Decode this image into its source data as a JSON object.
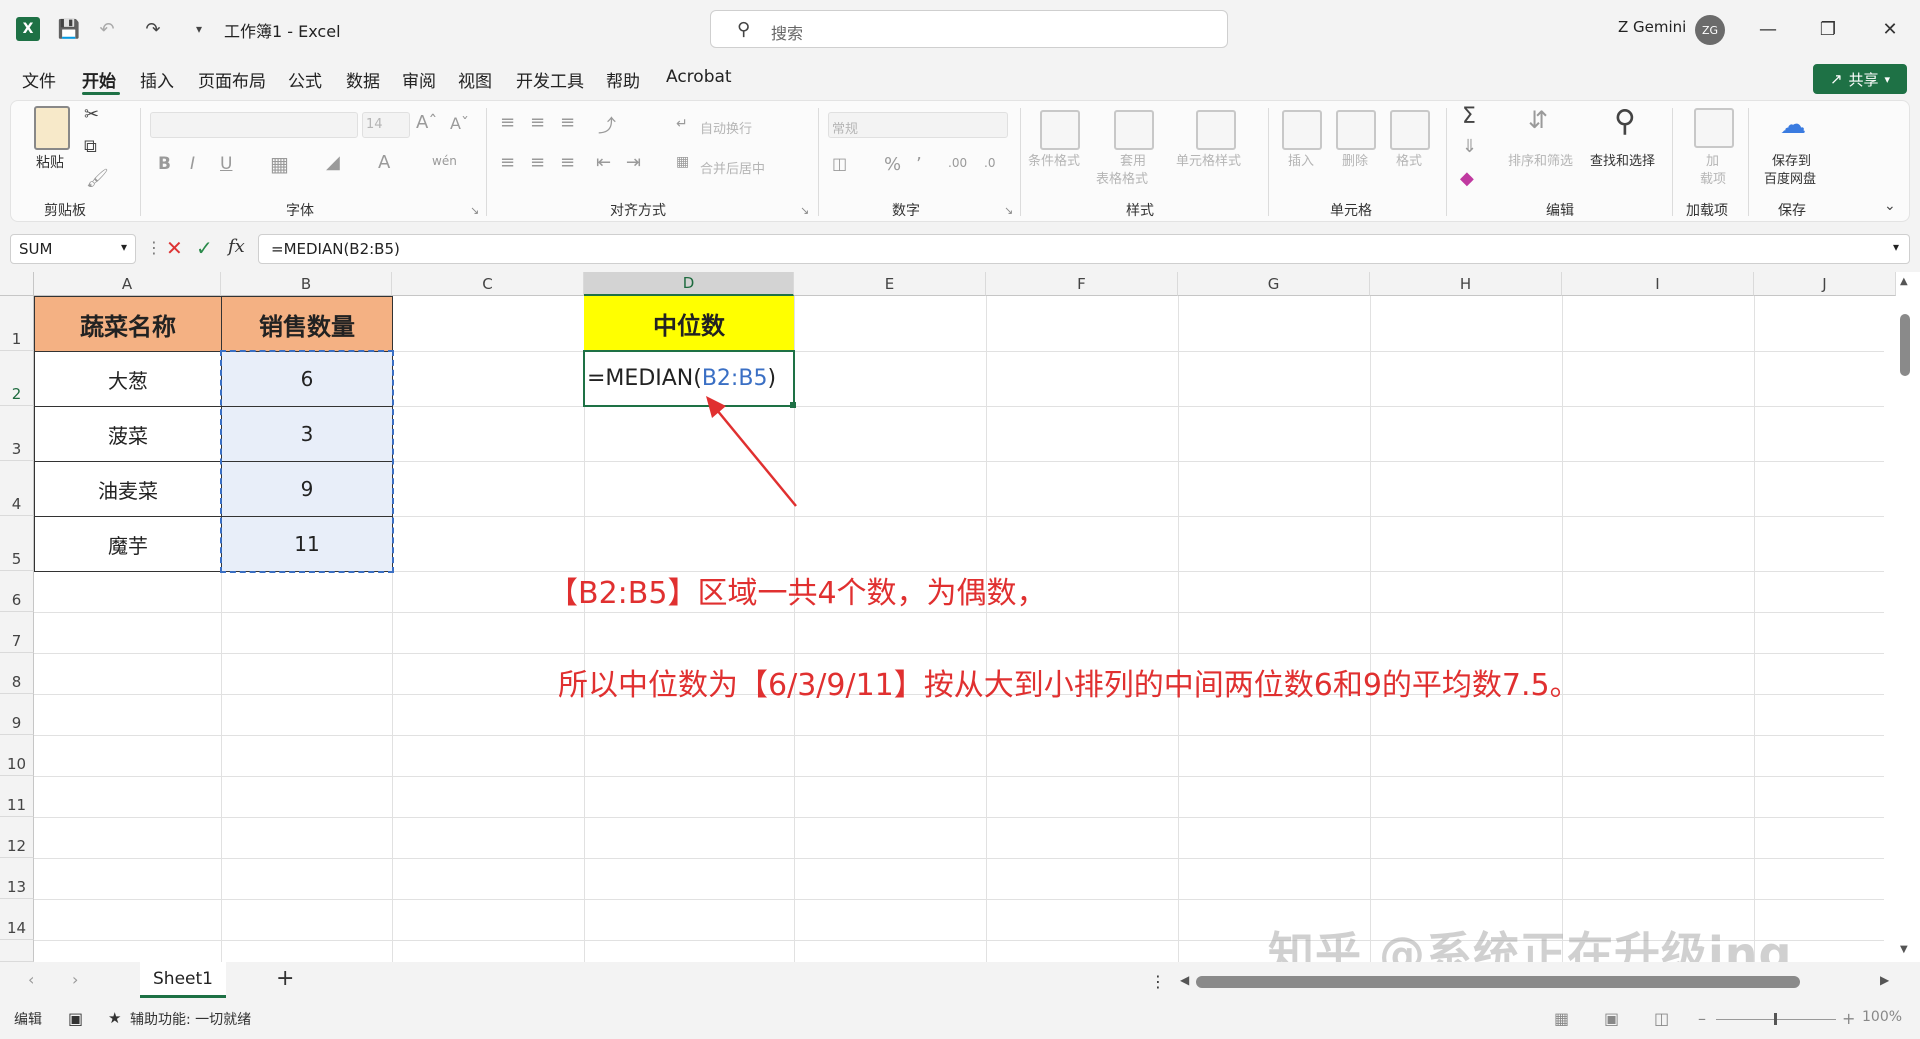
{
  "title_bar": {
    "doc_title": "工作簿1  -  Excel",
    "search_placeholder": "搜索",
    "user_name": "Z Gemini",
    "avatar_initials": "ZG"
  },
  "menu": {
    "tabs": [
      "文件",
      "开始",
      "插入",
      "页面布局",
      "公式",
      "数据",
      "审阅",
      "视图",
      "开发工具",
      "帮助",
      "Acrobat"
    ],
    "active": "开始",
    "share_label": "共享"
  },
  "ribbon": {
    "groups": {
      "clipboard": "剪贴板",
      "font": "字体",
      "alignment": "对齐方式",
      "number": "数字",
      "styles": "样式",
      "cells": "单元格",
      "editing": "编辑",
      "addins": "加载项",
      "save": "保存"
    },
    "paste_label": "粘贴",
    "font_size": "14",
    "wrap_text": "自动换行",
    "merge_center": "合并后居中",
    "number_format": "常规",
    "conditional_format": "条件格式",
    "table_format_1": "套用",
    "table_format_2": "表格格式",
    "cell_styles": "单元格样式",
    "insert": "插入",
    "delete": "删除",
    "format": "格式",
    "sort_filter": "排序和筛选",
    "find_select": "查找和选择",
    "addins_1": "加",
    "addins_2": "载项",
    "save_baidu_1": "保存到",
    "save_baidu_2": "百度网盘"
  },
  "formula_bar": {
    "name_box": "SUM",
    "formula": "=MEDIAN(B2:B5)"
  },
  "sheet": {
    "columns": [
      "A",
      "B",
      "C",
      "D",
      "E",
      "F",
      "G",
      "H",
      "I",
      "J"
    ],
    "rows": [
      "1",
      "2",
      "3",
      "4",
      "5",
      "6",
      "7",
      "8",
      "9",
      "10",
      "11",
      "12",
      "13",
      "14"
    ],
    "header_a": "蔬菜名称",
    "header_b": "销售数量",
    "header_d": "中位数",
    "table": [
      {
        "name": "大葱",
        "qty": "6"
      },
      {
        "name": "菠菜",
        "qty": "3"
      },
      {
        "name": "油麦菜",
        "qty": "9"
      },
      {
        "name": "魔芋",
        "qty": "11"
      }
    ],
    "d2_prefix": "=MEDIAN(",
    "d2_ref": "B2:B5",
    "d2_suffix": ")",
    "annotation_1": "【B2:B5】区域一共4个数，为偶数，",
    "annotation_2": "所以中位数为【6/3/9/11】按从大到小排列的中间两位数6和9的平均数7.5。",
    "watermark": "知乎 @系统正在升级ing",
    "colors": {
      "header_orange": "#f4b183",
      "header_yellow": "#ffff00",
      "annotation": "#e03030",
      "accent": "#1e7145",
      "ref_blue": "#3a6fc4"
    }
  },
  "tabs": {
    "sheet_name": "Sheet1",
    "add_sheet": "+"
  },
  "status": {
    "mode": "编辑",
    "accessibility": "辅助功能: 一切就绪",
    "zoom": "100%"
  }
}
